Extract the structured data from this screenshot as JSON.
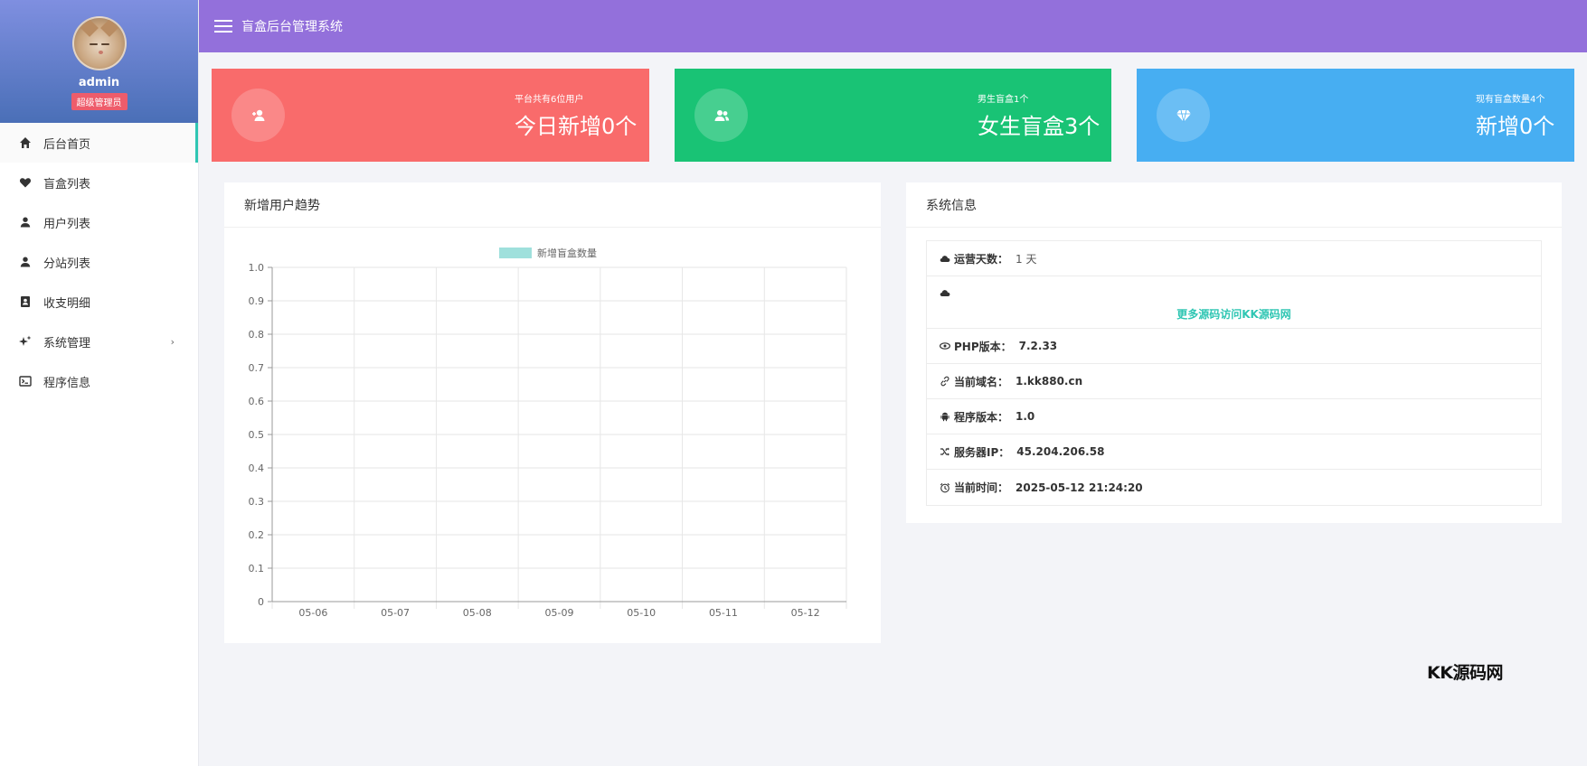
{
  "sidebar": {
    "username": "admin",
    "role": "超级管理员",
    "items": [
      {
        "label": "后台首页",
        "icon": "home-icon",
        "active": true
      },
      {
        "label": "盲盒列表",
        "icon": "heart-icon"
      },
      {
        "label": "用户列表",
        "icon": "user-icon"
      },
      {
        "label": "分站列表",
        "icon": "user-icon"
      },
      {
        "label": "收支明细",
        "icon": "contact-card-icon"
      },
      {
        "label": "系统管理",
        "icon": "sparkle-icon",
        "has_submenu": true
      },
      {
        "label": "程序信息",
        "icon": "terminal-icon"
      }
    ]
  },
  "header": {
    "title": "盲盒后台管理系统"
  },
  "cards": [
    {
      "small": "平台共有6位用户",
      "big": "今日新增0个",
      "icon": "add-user-icon",
      "color": "#f96b6b"
    },
    {
      "small": "男生盲盒1个",
      "big": "女生盲盒3个",
      "icon": "users-icon",
      "color": "#19c375"
    },
    {
      "small": "现有盲盒数量4个",
      "big": "新增0个",
      "icon": "diamond-icon",
      "color": "#47aef2"
    }
  ],
  "chart_panel": {
    "title": "新增用户趋势"
  },
  "chart_data": {
    "type": "bar",
    "title": "",
    "categories": [
      "05-06",
      "05-07",
      "05-08",
      "05-09",
      "05-10",
      "05-11",
      "05-12"
    ],
    "series": [
      {
        "name": "新增盲盒数量",
        "values": [
          0,
          0,
          0,
          0,
          0,
          0,
          0
        ],
        "color": "#9fe0dc"
      }
    ],
    "ylim": [
      0,
      1
    ],
    "yticks": [
      "0",
      "0.1",
      "0.2",
      "0.3",
      "0.4",
      "0.5",
      "0.6",
      "0.7",
      "0.8",
      "0.9",
      "1.0"
    ],
    "grid": true,
    "legend": "top"
  },
  "info_panel": {
    "title": "系统信息",
    "run_days_label": "运营天数：",
    "run_days_value": "1 天",
    "promo_link": "更多源码访问KK源码网",
    "php_label": "PHP版本：",
    "php_value": "7.2.33",
    "domain_label": "当前域名：",
    "domain_value": "1.kk880.cn",
    "version_label": "程序版本：",
    "version_value": "1.0",
    "ip_label": "服务器IP：",
    "ip_value": "45.204.206.58",
    "time_label": "当前时间：",
    "time_value": "2025-05-12 21:24:20"
  },
  "watermark": "KK源码网"
}
